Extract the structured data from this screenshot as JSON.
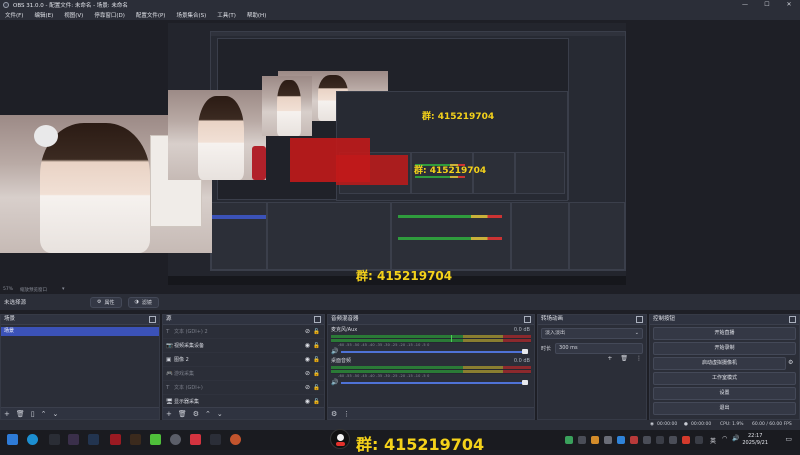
{
  "window": {
    "title": "OBS 31.0.0 - 配置文件: 未命名 - 场景: 未命名",
    "controls": [
      "—",
      "☐",
      "✕"
    ]
  },
  "menu": [
    "文件(F)",
    "编辑(E)",
    "视图(V)",
    "停靠窗口(D)",
    "配置文件(P)",
    "场景集合(S)",
    "工具(T)",
    "帮助(H)"
  ],
  "preview": {
    "group_text": "群: 415219704",
    "nested_group_text_1": "群: 415219704",
    "nested_group_text_2": "群: 415219704",
    "zoom_label": "57%",
    "zoom_hint": "缩放预览窗口"
  },
  "source_toolbar": {
    "no_source": "未选择源",
    "properties": "属性",
    "filters": "滤镜"
  },
  "scenes": {
    "title": "场景",
    "items": [
      "场景"
    ],
    "footer": [
      "+",
      "🗑",
      "▯",
      "⌃",
      "⌄"
    ]
  },
  "sources": {
    "title": "源",
    "items": [
      {
        "icon": "T",
        "name": "文本 (GDI+) 2",
        "visible": false
      },
      {
        "icon": "📷",
        "name": "视频采集设备",
        "visible": true
      },
      {
        "icon": "▣",
        "name": "图像 2",
        "visible": true
      },
      {
        "icon": "🎮",
        "name": "游戏采集",
        "visible": false
      },
      {
        "icon": "T",
        "name": "文本 (GDI+)",
        "visible": false
      },
      {
        "icon": "🖥",
        "name": "显示器采集",
        "visible": true
      }
    ],
    "footer": [
      "+",
      "🗑",
      "⚙",
      "⌃",
      "⌄"
    ]
  },
  "mixer": {
    "title": "音频混音器",
    "channels": [
      {
        "name": "麦克风/Aux",
        "db": "0.0 dB",
        "level": 0.6
      },
      {
        "name": "桌面音频",
        "db": "0.0 dB",
        "level": 0.0
      }
    ],
    "scale": "-60 -55 -50 -45 -40 -35 -30 -25 -20 -15 -10 -5 0",
    "footer": [
      "⚙",
      "⋮"
    ]
  },
  "transitions": {
    "title": "转场动画",
    "selected": "淡入淡出",
    "duration_label": "时长",
    "duration_value": "300 ms",
    "footer": [
      "+",
      "🗑",
      "⋮"
    ]
  },
  "controls": {
    "title": "控制按钮",
    "buttons": [
      "开始直播",
      "开始录制",
      "启动虚拟摄像机",
      "工作室模式",
      "设置",
      "退出"
    ]
  },
  "status": {
    "stream_time": "00:00:00",
    "rec_time": "00:00:00",
    "cpu": "CPU: 1.9%",
    "fps": "60.00 / 60.00 FPS"
  },
  "taskbar": {
    "group_text": "群: 415219704",
    "lang": "英",
    "time": "22:17",
    "date": "2025/9/21"
  },
  "colors": {
    "accent_blue": "#3b52b8",
    "overlay_yellow": "#f5d21a"
  }
}
